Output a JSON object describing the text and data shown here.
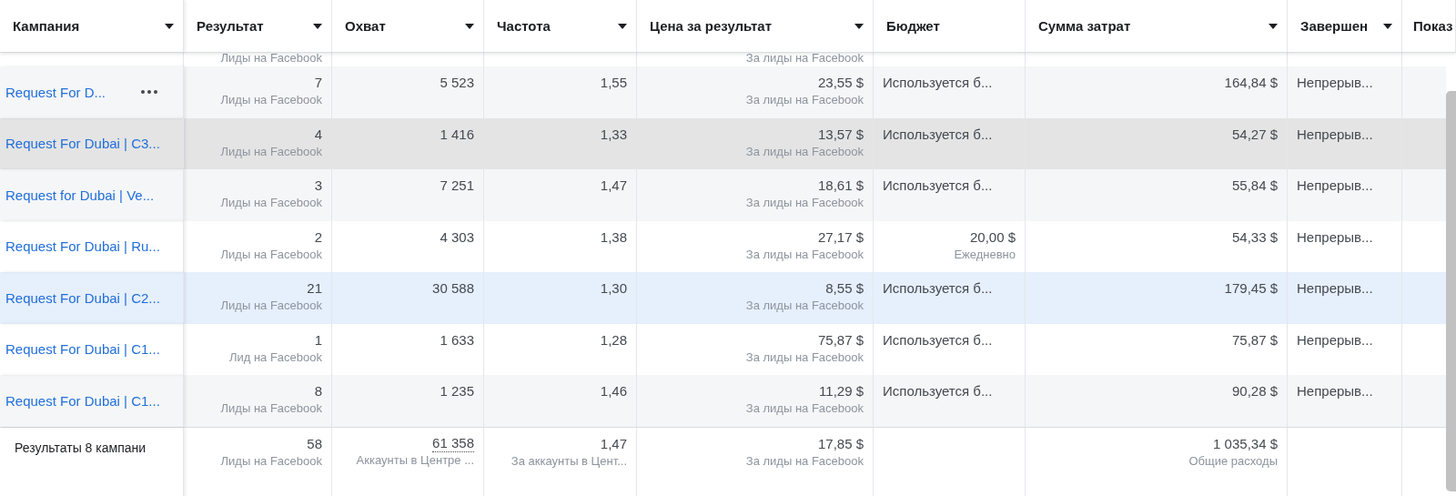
{
  "columns": [
    {
      "label": "Кампания",
      "sortable": true
    },
    {
      "label": "Результат",
      "sortable": true
    },
    {
      "label": "Охват",
      "sortable": true
    },
    {
      "label": "Частота",
      "sortable": true
    },
    {
      "label": "Цена за результат",
      "sortable": true
    },
    {
      "label": "Бюджет",
      "sortable": false
    },
    {
      "label": "Сумма затрат",
      "sortable": true
    },
    {
      "label": "Завершен",
      "sortable": true
    },
    {
      "label": "Показ"
    }
  ],
  "partial_row": {
    "cells": [
      {
        "sub": "Лиды на Facebook"
      },
      {
        "sub": "За лиды на Facebook"
      }
    ]
  },
  "rows": [
    {
      "campaign": "Request For D...",
      "hovered": true,
      "selected": false,
      "highlighted": false,
      "cells": [
        {
          "kind": "number",
          "value": "7",
          "sub": "Лиды на Facebook"
        },
        {
          "kind": "number",
          "value": "5 523"
        },
        {
          "kind": "number",
          "value": "1,55"
        },
        {
          "kind": "number",
          "value": "23,55 $",
          "sub": "За лиды на Facebook"
        },
        {
          "kind": "text",
          "value": "Используется б..."
        },
        {
          "kind": "number",
          "value": "164,84 $"
        },
        {
          "kind": "text",
          "value": "Непрерыв..."
        }
      ]
    },
    {
      "campaign": "Request For Dubai | C3...",
      "hovered": false,
      "selected": true,
      "highlighted": false,
      "cells": [
        {
          "kind": "number",
          "value": "4",
          "sub": "Лиды на Facebook"
        },
        {
          "kind": "number",
          "value": "1 416"
        },
        {
          "kind": "number",
          "value": "1,33"
        },
        {
          "kind": "number",
          "value": "13,57 $",
          "sub": "За лиды на Facebook"
        },
        {
          "kind": "text",
          "value": "Используется б..."
        },
        {
          "kind": "number",
          "value": "54,27 $"
        },
        {
          "kind": "text",
          "value": "Непрерыв..."
        }
      ]
    },
    {
      "campaign": "Request for Dubai | Ve...",
      "hovered": false,
      "selected": false,
      "highlighted": false,
      "cells": [
        {
          "kind": "number",
          "value": "3",
          "sub": "Лиды на Facebook"
        },
        {
          "kind": "number",
          "value": "7 251"
        },
        {
          "kind": "number",
          "value": "1,47"
        },
        {
          "kind": "number",
          "value": "18,61 $",
          "sub": "За лиды на Facebook"
        },
        {
          "kind": "text",
          "value": "Используется б..."
        },
        {
          "kind": "number",
          "value": "55,84 $"
        },
        {
          "kind": "text",
          "value": "Непрерыв..."
        }
      ]
    },
    {
      "campaign": "Request For Dubai | Ru...",
      "hovered": false,
      "selected": false,
      "highlighted": false,
      "cells": [
        {
          "kind": "number",
          "value": "2",
          "sub": "Лиды на Facebook"
        },
        {
          "kind": "number",
          "value": "4 303"
        },
        {
          "kind": "number",
          "value": "1,38"
        },
        {
          "kind": "number",
          "value": "27,17 $",
          "sub": "За лиды на Facebook"
        },
        {
          "kind": "number",
          "value": "20,00 $",
          "sub": "Ежедневно"
        },
        {
          "kind": "number",
          "value": "54,33 $"
        },
        {
          "kind": "text",
          "value": "Непрерыв..."
        }
      ]
    },
    {
      "campaign": "Request For Dubai | C2...",
      "hovered": false,
      "selected": false,
      "highlighted": true,
      "cells": [
        {
          "kind": "number",
          "value": "21",
          "sub": "Лиды на Facebook"
        },
        {
          "kind": "number",
          "value": "30 588"
        },
        {
          "kind": "number",
          "value": "1,30"
        },
        {
          "kind": "number",
          "value": "8,55 $",
          "sub": "За лиды на Facebook"
        },
        {
          "kind": "text",
          "value": "Используется б..."
        },
        {
          "kind": "number",
          "value": "179,45 $"
        },
        {
          "kind": "text",
          "value": "Непрерыв..."
        }
      ]
    },
    {
      "campaign": "Request For Dubai | C1...",
      "hovered": false,
      "selected": false,
      "highlighted": false,
      "cells": [
        {
          "kind": "number",
          "value": "1",
          "sub": "Лид на Facebook"
        },
        {
          "kind": "number",
          "value": "1 633"
        },
        {
          "kind": "number",
          "value": "1,28"
        },
        {
          "kind": "number",
          "value": "75,87 $",
          "sub": "За лиды на Facebook"
        },
        {
          "kind": "text",
          "value": "Используется б..."
        },
        {
          "kind": "number",
          "value": "75,87 $"
        },
        {
          "kind": "text",
          "value": "Непрерыв..."
        }
      ]
    },
    {
      "campaign": "Request For Dubai | C1...",
      "hovered": false,
      "selected": false,
      "highlighted": false,
      "cells": [
        {
          "kind": "number",
          "value": "8",
          "sub": "Лиды на Facebook"
        },
        {
          "kind": "number",
          "value": "1 235"
        },
        {
          "kind": "number",
          "value": "1,46"
        },
        {
          "kind": "number",
          "value": "11,29 $",
          "sub": "За лиды на Facebook"
        },
        {
          "kind": "text",
          "value": "Используется б..."
        },
        {
          "kind": "number",
          "value": "90,28 $"
        },
        {
          "kind": "text",
          "value": "Непрерыв..."
        }
      ]
    }
  ],
  "totals": {
    "label": "Результаты 8 кампани",
    "cells": [
      {
        "value": "58",
        "sub": "Лиды на Facebook"
      },
      {
        "value": "61 358",
        "sub": "Аккаунты в Центре ...",
        "dotted": true
      },
      {
        "value": "1,47",
        "sub": "За аккаунты в Цент..."
      },
      {
        "value": "17,85 $",
        "sub": "За лиды на Facebook"
      },
      {},
      {
        "value": "1 035,34 $",
        "sub": "Общие расходы"
      },
      {}
    ]
  }
}
